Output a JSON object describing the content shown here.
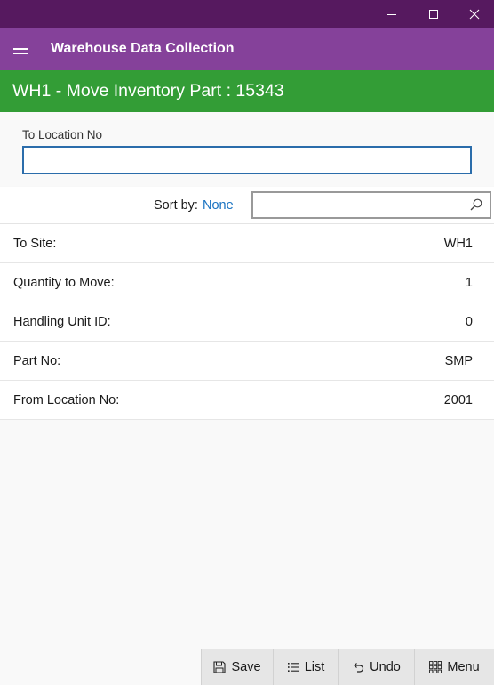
{
  "window": {
    "controls": {
      "minimize_icon": "minimize-icon",
      "maximize_icon": "maximize-icon",
      "close_icon": "close-icon"
    }
  },
  "app": {
    "title": "Warehouse Data Collection",
    "menu_icon": "hamburger-icon"
  },
  "page": {
    "title": "WH1 - Move Inventory Part : 15343"
  },
  "input": {
    "label": "To Location No",
    "value": ""
  },
  "sort": {
    "label": "Sort by:",
    "value": "None",
    "search_placeholder": "",
    "search_icon": "search-icon"
  },
  "details": [
    {
      "label": "To Site:",
      "value": "WH1"
    },
    {
      "label": "Quantity to Move:",
      "value": "1"
    },
    {
      "label": "Handling Unit ID:",
      "value": "0"
    },
    {
      "label": "Part No:",
      "value": "SMP"
    },
    {
      "label": "From Location No:",
      "value": "2001"
    }
  ],
  "commands": {
    "save": {
      "label": "Save",
      "icon": "save-icon"
    },
    "list": {
      "label": "List",
      "icon": "list-icon"
    },
    "undo": {
      "label": "Undo",
      "icon": "undo-icon"
    },
    "menu": {
      "label": "Menu",
      "icon": "grid-menu-icon"
    }
  },
  "colors": {
    "titlebar": "#56195f",
    "appbar": "#85419a",
    "page_header": "#339d36",
    "accent_link": "#1a73c2",
    "input_border": "#2b6dab"
  }
}
